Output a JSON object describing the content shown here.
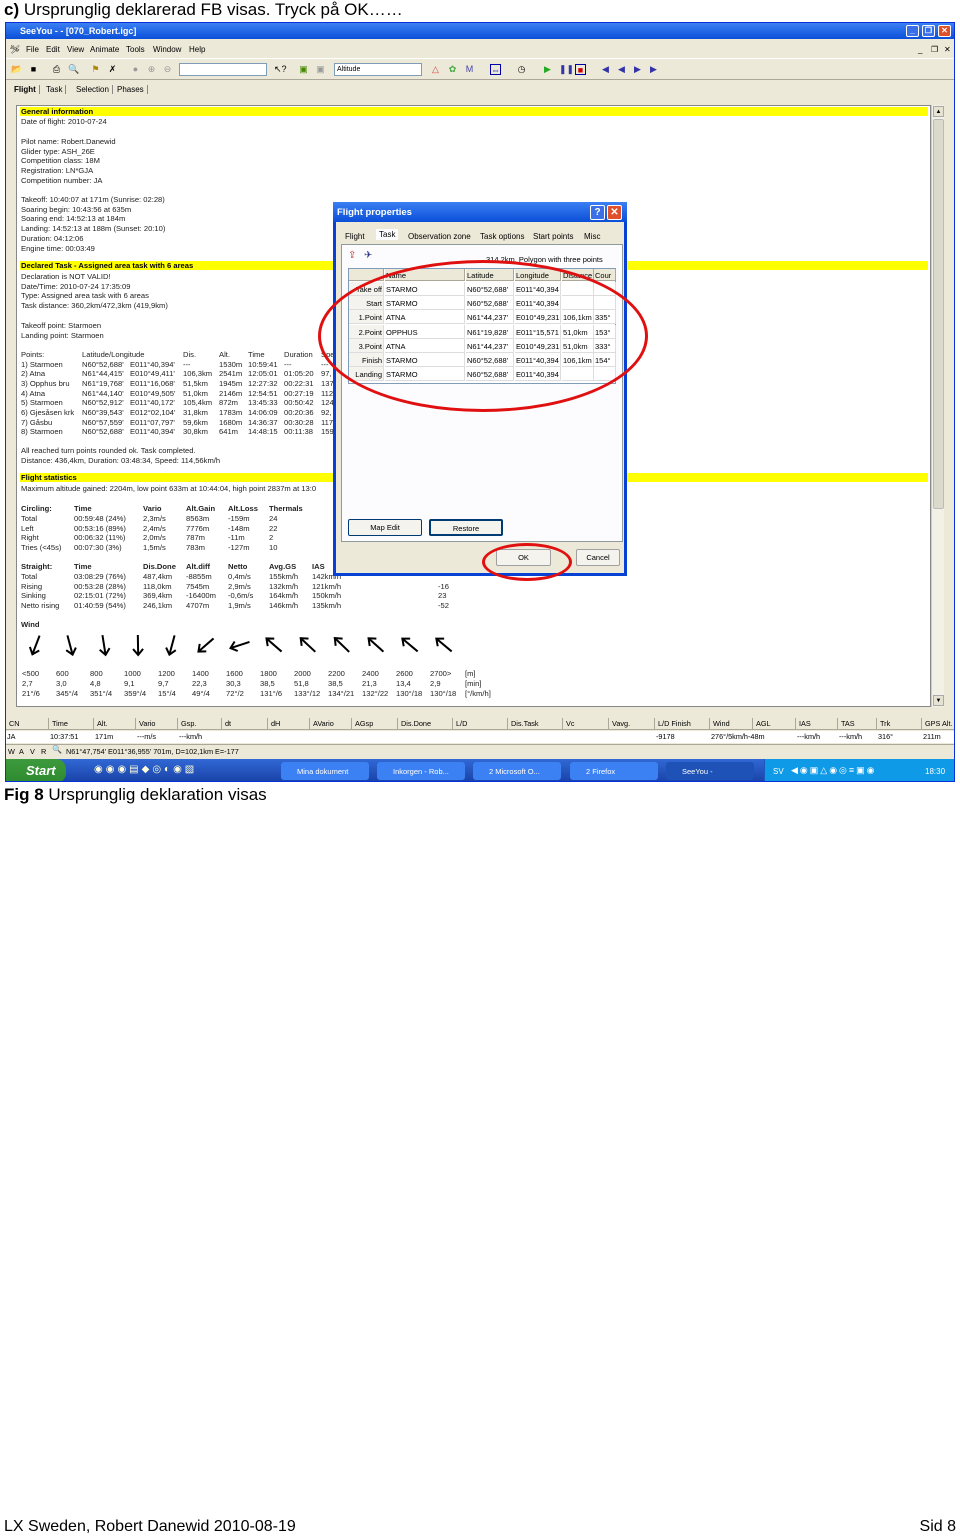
{
  "caption_top": {
    "prefix": "c)",
    "text": "Ursprunglig deklarerad FB visas. Tryck på OK……"
  },
  "window": {
    "title": "SeeYou -  - [070_Robert.igc]",
    "controls": [
      "_",
      "❐",
      "✕"
    ],
    "menu": [
      "File",
      "Edit",
      "View",
      "Animate",
      "Tools",
      "Window",
      "Help"
    ],
    "mdi_controls": [
      "_",
      "❐",
      "✕"
    ],
    "toolbar": {
      "combo_value": "",
      "altitude_select": "Altitude"
    },
    "tabs": [
      "Flight",
      "Task",
      "Selection",
      "Phases"
    ]
  },
  "report": {
    "general_header": "General information",
    "date_of_flight": "Date of flight:  2010-07-24",
    "pilot_lines": [
      "Pilot name:  Robert.Danewid",
      "Glider type:  ASH_26E",
      "Competition class:  18M",
      "Registration:  LN*GJA",
      "Competition number:  JA"
    ],
    "times_lines": [
      "Takeoff:  10:40:07 at 171m (Sunrise:  02:28)",
      "Soaring begin:  10:43:56 at 635m",
      "Soaring end:  14:52:13 at 184m",
      "Landing:  14:52:13 at 188m (Sunset:  20:10)",
      "Duration:  04:12:06",
      "Engine time:  00:03:49"
    ],
    "task_header": "Declared Task - Assigned area task with 6 areas",
    "task_lines": [
      "Declaration is NOT VALID!",
      "Date/Time: 2010-07-24 17:35:09",
      "Type: Assigned area task with 6 areas",
      "Task distance: 360,2km/472,3km (419,9km)"
    ],
    "point_lines": [
      "Takeoff point:  Starmoen",
      "Landing point:  Starmoen"
    ],
    "points": {
      "headers": [
        "Points:",
        "Latitude/Longitude",
        "",
        "Dis.",
        "Alt.",
        "Time",
        "Duration",
        "Spe"
      ],
      "rows": [
        [
          "1) Starmoen",
          "N60°52,688'",
          "E011°40,394'",
          "---",
          "1530m",
          "10:59:41",
          "---",
          "---"
        ],
        [
          "2) Atna",
          "N61°44,415'",
          "E010°49,411'",
          "106,3km",
          "2541m",
          "12:05:01",
          "01:05:20",
          "97,"
        ],
        [
          "3) Opphus bru",
          "N61°19,768'",
          "E011°16,068'",
          "51,5km",
          "1945m",
          "12:27:32",
          "00:22:31",
          "137"
        ],
        [
          "4) Atna",
          "N61°44,140'",
          "E010°49,505'",
          "51,0km",
          "2146m",
          "12:54:51",
          "00:27:19",
          "112"
        ],
        [
          "5) Starmoen",
          "N60°52,912'",
          "E011°40,172'",
          "105,4km",
          "872m",
          "13:45:33",
          "00:50:42",
          "124"
        ],
        [
          "6) Gjesåsen krk",
          "N60°39,543'",
          "E012°02,104'",
          "31,8km",
          "1783m",
          "14:06:09",
          "00:20:36",
          "92,"
        ],
        [
          "7) Gåsbu",
          "N60°57,559'",
          "E011°07,797'",
          "59,6km",
          "1680m",
          "14:36:37",
          "00:30:28",
          "117"
        ],
        [
          "8) Starmoen",
          "N60°52,688'",
          "E011°40,394'",
          "30,8km",
          "641m",
          "14:48:15",
          "00:11:38",
          "159"
        ]
      ]
    },
    "result_lines": [
      "All reached turn points rounded ok. Task completed.",
      "Distance: 436,4km, Duration: 03:48:34, Speed: 114,56km/h"
    ],
    "stats_header": "Flight statistics",
    "max_alt_line": "Maximum altitude gained: 2204m, low point 633m at 10:44:04, high point 2837m at 13:0",
    "circling": {
      "headers": [
        "Circling:",
        "Time",
        "Vario",
        "Alt.Gain",
        "Alt.Loss",
        "Thermals"
      ],
      "rows": [
        [
          "Total",
          "00:59:48 (24%)",
          "2,3m/s",
          "8563m",
          "-159m",
          "24"
        ],
        [
          "Left",
          "00:53:16 (89%)",
          "2,4m/s",
          "7776m",
          "-148m",
          "22"
        ],
        [
          "Right",
          "00:06:32 (11%)",
          "2,0m/s",
          "787m",
          "-11m",
          "2"
        ],
        [
          "Tries (<45s)",
          "00:07:30 (3%)",
          "1,5m/s",
          "783m",
          "-127m",
          "10"
        ]
      ]
    },
    "straight": {
      "headers": [
        "Straight:",
        "Time",
        "Dis.Done",
        "Alt.diff",
        "Netto",
        "Avg.GS",
        "IAS",
        ""
      ],
      "rows": [
        [
          "Total",
          "03:08:29 (76%)",
          "487,4km",
          "-8855m",
          "0,4m/s",
          "155km/h",
          "142km/h",
          ""
        ],
        [
          "Rising",
          "00:53:28 (28%)",
          "118,0km",
          "7545m",
          "2,9m/s",
          "132km/h",
          "121km/h",
          "-16"
        ],
        [
          "Sinking",
          "02:15:01 (72%)",
          "369,4km",
          "-16400m",
          "-0,6m/s",
          "164km/h",
          "150km/h",
          "23"
        ],
        [
          "Netto rising",
          "01:40:59 (54%)",
          "246,1km",
          "4707m",
          "1,9m/s",
          "146km/h",
          "135km/h",
          "-52"
        ]
      ]
    },
    "wind": {
      "header": "Wind",
      "altitudes": [
        "<500",
        "600",
        "800",
        "1000",
        "1200",
        "1400",
        "1600",
        "1800",
        "2000",
        "2200",
        "2400",
        "2600",
        "2700>"
      ],
      "minutes": [
        "2,7",
        "3,0",
        "4,8",
        "9,1",
        "9,7",
        "22,3",
        "30,3",
        "38,5",
        "51,8",
        "38,5",
        "21,3",
        "13,4",
        "2,9"
      ],
      "dir_speed": [
        "21°/6",
        "345°/4",
        "351°/4",
        "359°/4",
        "15°/4",
        "49°/4",
        "72°/2",
        "131°/6",
        "133°/12",
        "134°/21",
        "132°/22",
        "130°/18",
        "130°/18"
      ],
      "directions_deg": [
        21,
        345,
        351,
        359,
        15,
        49,
        72,
        131,
        133,
        134,
        132,
        130,
        130
      ],
      "units": [
        "[m]",
        "[min]",
        "[°/km/h]"
      ]
    }
  },
  "status": {
    "headers": [
      "CN",
      "Time",
      "Alt.",
      "Vario",
      "Gsp.",
      "dt",
      "dH",
      "AVario",
      "AGsp",
      "Dis.Done",
      "L/D",
      "Dis.Task",
      "Vc",
      "Vavg.",
      "L/D Finish",
      "Wind",
      "AGL",
      "IAS",
      "TAS",
      "Trk",
      "GPS Alt."
    ],
    "values": [
      "JA",
      "10:37:51",
      "171m",
      "---m/s",
      "---km/h",
      "",
      "",
      "",
      "",
      "",
      "",
      "",
      "",
      "",
      "-9178",
      "276°/5km/h-48m",
      "",
      "---km/h",
      "---km/h",
      "316°",
      "211m"
    ],
    "modes": [
      "W",
      "A",
      "V",
      "R"
    ],
    "coords": "N61°47,754' E011°36,955' 701m, D=102,1km E=-177"
  },
  "taskbar": {
    "start": "Start",
    "tasks": [
      "Mina dokument",
      "Inkorgen - Rob...",
      "2 Microsoft O...",
      "2 Firefox",
      "SeeYou -"
    ],
    "lang": "SV",
    "clock": "18:30"
  },
  "dialog": {
    "title": "Flight properties",
    "tabs": [
      "Flight",
      "Task",
      "Observation zone",
      "Task options",
      "Start points",
      "Misc"
    ],
    "summary": "314,2km, Polygon with three points",
    "headers": [
      "",
      "Name",
      "Latitude",
      "Longitude",
      "Distance",
      "Cour"
    ],
    "rows": [
      [
        "Take off",
        "STARMO",
        "N60°52,688'",
        "E011°40,394",
        "",
        ""
      ],
      [
        "Start",
        "STARMO",
        "N60°52,688'",
        "E011°40,394",
        "",
        ""
      ],
      [
        "1.Point",
        "ATNA",
        "N61°44,237'",
        "E010°49,231",
        "106,1km",
        "335°"
      ],
      [
        "2.Point",
        "OPPHUS",
        "N61°19,828'",
        "E011°15,571",
        "51,0km",
        "153°"
      ],
      [
        "3.Point",
        "ATNA",
        "N61°44,237'",
        "E010°49,231",
        "51,0km",
        "333°"
      ],
      [
        "Finish",
        "STARMO",
        "N60°52,688'",
        "E011°40,394",
        "106,1km",
        "154°"
      ],
      [
        "Landing",
        "STARMO",
        "N60°52,688'",
        "E011°40,394",
        "",
        ""
      ]
    ],
    "buttons": {
      "map_edit": "Map Edit",
      "restore": "Restore",
      "ok": "OK",
      "cancel": "Cancel"
    },
    "highlight_color": "#e01010"
  },
  "caption_bottom": {
    "prefix": "Fig 8",
    "text": "Ursprunglig deklaration visas"
  },
  "footer": {
    "left": "LX Sweden, Robert Danewid 2010-08-19",
    "right": "Sid 8"
  }
}
